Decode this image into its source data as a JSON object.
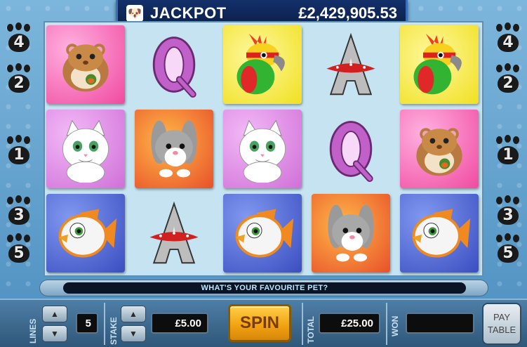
{
  "jackpot": {
    "label": "JACKPOT",
    "amount": "£2,429,905.53",
    "icon": "dog-icon"
  },
  "paylines_left": [
    "4",
    "2",
    "1",
    "3",
    "5"
  ],
  "paylines_right": [
    "4",
    "2",
    "1",
    "3",
    "5"
  ],
  "reels": [
    [
      "hamster",
      "cat",
      "goldfish"
    ],
    [
      "queen",
      "rabbit",
      "ace"
    ],
    [
      "parrot",
      "cat",
      "goldfish"
    ],
    [
      "ace",
      "queen",
      "rabbit"
    ],
    [
      "parrot",
      "hamster",
      "goldfish"
    ]
  ],
  "message": "WHAT'S YOUR FAVOURITE PET?",
  "controls": {
    "lines_label": "LINES",
    "lines_value": "5",
    "stake_label": "STAKE",
    "stake_value": "£5.00",
    "spin_label": "SPIN",
    "total_label": "TOTAL",
    "total_value": "£25.00",
    "won_label": "WON",
    "won_value": "",
    "paytable_line1": "PAY",
    "paytable_line2": "TABLE"
  },
  "colors": {
    "hamster_bg": "#f04aa0",
    "cat_bg": "#d070d8",
    "goldfish_bg": "#3a4ec0",
    "rabbit_bg": "#e8502a",
    "parrot_bg": "#f0e020",
    "spin_button": "#f0a010"
  }
}
